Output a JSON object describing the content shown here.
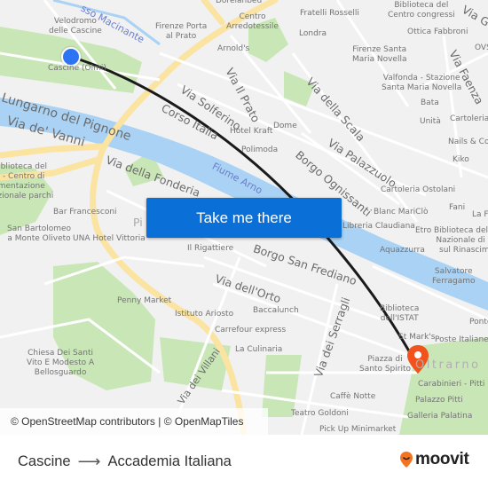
{
  "map": {
    "origin_marker": {
      "label": "Cascine (Olmi)",
      "color": "#2d74f5"
    },
    "destination_marker": {
      "color": "#f2531d"
    },
    "route_color": "#1a1a1a",
    "colors": {
      "land": "#f1f1f1",
      "water": "#a9d2f4",
      "park": "#c8e6b4",
      "major_road": "#fbe6a0",
      "minor_road": "#ffffff"
    },
    "streets": [
      {
        "name": "Lungarno del Pignone"
      },
      {
        "name": "Via de' Vanni"
      },
      {
        "name": "Via della Fonderia"
      },
      {
        "name": "Corso Italia"
      },
      {
        "name": "Via Solferino"
      },
      {
        "name": "Via Il Prato"
      },
      {
        "name": "Via della Scala"
      },
      {
        "name": "Via Palazzuolo"
      },
      {
        "name": "Borgo Ognissanti"
      },
      {
        "name": "Via Faenza"
      },
      {
        "name": "Via G"
      },
      {
        "name": "Borgo San Frediano"
      },
      {
        "name": "Via dell'Orto"
      },
      {
        "name": "Via dei Serragli"
      },
      {
        "name": "Via dei Villani"
      },
      {
        "name": "sso Macinante"
      }
    ],
    "water_labels": [
      {
        "name": "Fiume Arno"
      }
    ],
    "district": "Oltrarno",
    "pois": [
      {
        "name": "Velodromo\ndelle Cascine"
      },
      {
        "name": "Cascine (Olmi)"
      },
      {
        "name": "Firenze Porta\nal Prato"
      },
      {
        "name": "Dorelanbed"
      },
      {
        "name": "Centro\nArredotessile"
      },
      {
        "name": "Fratelli Rosselli"
      },
      {
        "name": "Londra"
      },
      {
        "name": "Biblioteca del\nCentro congressi"
      },
      {
        "name": "Ottica Fabbroni"
      },
      {
        "name": "Firenze Santa\nMaria Novella"
      },
      {
        "name": "Valfonda - Stazione\nSanta Maria Novella"
      },
      {
        "name": "OVS"
      },
      {
        "name": "Arnold's"
      },
      {
        "name": "Bata"
      },
      {
        "name": "Unità"
      },
      {
        "name": "Cartoleria"
      },
      {
        "name": "Nails & Co"
      },
      {
        "name": "Kiko"
      },
      {
        "name": "Hotel Kraft"
      },
      {
        "name": "Dome"
      },
      {
        "name": "Polimoda"
      },
      {
        "name": "Cartoleria Ostolani"
      },
      {
        "name": "Blanc MariClò"
      },
      {
        "name": "Fani"
      },
      {
        "name": "La Fe"
      },
      {
        "name": "Libreria Claudiana"
      },
      {
        "name": "Etro"
      },
      {
        "name": "Biblioteca dell'I\nNazionale di S\nsul Rinascim"
      },
      {
        "name": "Aquazzurra"
      },
      {
        "name": "Salvatore\nFerragamo"
      },
      {
        "name": "Biblioteca\ndell'ISTAT"
      },
      {
        "name": "Ponte"
      },
      {
        "name": "St Mark's"
      },
      {
        "name": "Poste Italiane"
      },
      {
        "name": "Piazza di\nSanto Spirito"
      },
      {
        "name": "Carabinieri - Pitti"
      },
      {
        "name": "Palazzo Pitti"
      },
      {
        "name": "Galleria Palatina"
      },
      {
        "name": "Caffè Notte"
      },
      {
        "name": "Teatro Goldoni"
      },
      {
        "name": "Pick Up Minimarket"
      },
      {
        "name": "Biblioteca del\nIP - Centro di\numentazione\nazionale parchi"
      },
      {
        "name": "Bar Francesconi"
      },
      {
        "name": "San Bartolomeo\na Monte Oliveto"
      },
      {
        "name": "UNA Hotel Vittoria"
      },
      {
        "name": "Il Rigattiere"
      },
      {
        "name": "Penny Market"
      },
      {
        "name": "Istituto Ariosto"
      },
      {
        "name": "Carrefour express"
      },
      {
        "name": "Baccalunch"
      },
      {
        "name": "La Culinaria"
      },
      {
        "name": "Chiesa Dei Santi\nVito E Modesto A\nBellosguardo"
      },
      {
        "name": "Pi"
      }
    ],
    "attribution": "© OpenStreetMap contributors | © OpenMapTiles"
  },
  "cta": {
    "label": "Take me there",
    "color": "#0a70d8"
  },
  "footer": {
    "origin": "Cascine",
    "arrow": "⟶",
    "destination": "Accademia Italiana",
    "brand": "moovit",
    "brand_color": "#f47321"
  }
}
